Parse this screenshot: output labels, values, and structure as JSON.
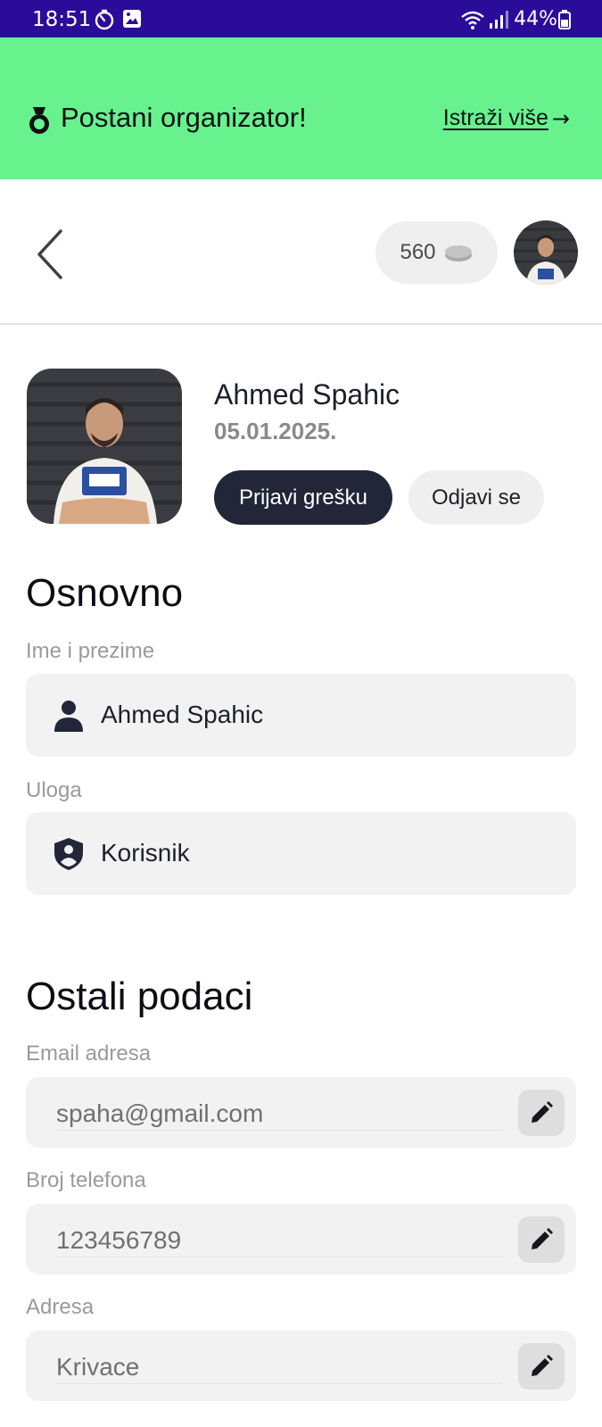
{
  "status_bar": {
    "time": "18:51",
    "battery": "44%"
  },
  "promo": {
    "title": "Postani organizator!",
    "link_label": "Istraži više",
    "arrow": "→",
    "background": "#67f28e"
  },
  "header": {
    "coins": "560"
  },
  "profile": {
    "name": "Ahmed Spahic",
    "date": "05.01.2025.",
    "report_button": "Prijavi grešku",
    "logout_button": "Odjavi se"
  },
  "basic_section": {
    "title": "Osnovno",
    "name_label": "Ime i prezime",
    "name_value": "Ahmed Spahic",
    "role_label": "Uloga",
    "role_value": "Korisnik"
  },
  "other_section": {
    "title": "Ostali podaci",
    "email_label": "Email adresa",
    "email_value": "spaha@gmail.com",
    "phone_label": "Broj telefona",
    "phone_value": "123456789",
    "address_label": "Adresa",
    "address_value": "Krivace"
  },
  "icons": {
    "status": [
      "timer-icon",
      "image-icon",
      "wifi-icon",
      "signal-icon",
      "battery-icon"
    ],
    "promo": "medal-icon",
    "header": [
      "back-chevron-icon",
      "coin-icon"
    ],
    "fields": [
      "person-icon",
      "shield-user-icon",
      "pencil-icon"
    ]
  },
  "colors": {
    "status_bar": "#2a0c9b",
    "dark_button": "#222638",
    "field_bg": "#f2f2f2"
  }
}
